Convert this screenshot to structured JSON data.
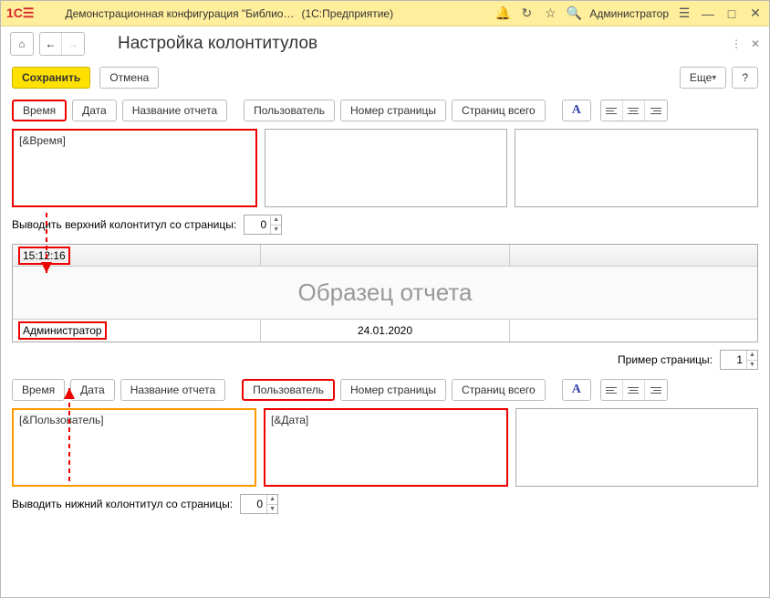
{
  "titlebar": {
    "config_name": "Демонстрационная конфигурация \"Библио…",
    "platform": "(1С:Предприятие)",
    "user": "Администратор"
  },
  "page": {
    "title": "Настройка колонтитулов",
    "save": "Сохранить",
    "cancel": "Отмена",
    "more": "Еще",
    "help": "?"
  },
  "insert": {
    "time": "Время",
    "date": "Дата",
    "report_name": "Название отчета",
    "user": "Пользователь",
    "page_number": "Номер страницы",
    "page_total": "Страниц всего",
    "font": "A"
  },
  "header": {
    "left": "[&Время]",
    "center": "",
    "right": "",
    "from_page_label": "Выводить верхний колонтитул со страницы:",
    "from_page": "0"
  },
  "preview": {
    "head_left": "15:12:16",
    "body": "Образец отчета",
    "foot_left": "Администратор",
    "foot_center": "24.01.2020",
    "foot_right": "",
    "example_label": "Пример страницы:",
    "example_value": "1"
  },
  "footer": {
    "left": "[&Пользователь]",
    "center": "[&Дата]",
    "right": "",
    "from_page_label": "Выводить нижний колонтитул со страницы:",
    "from_page": "0"
  }
}
